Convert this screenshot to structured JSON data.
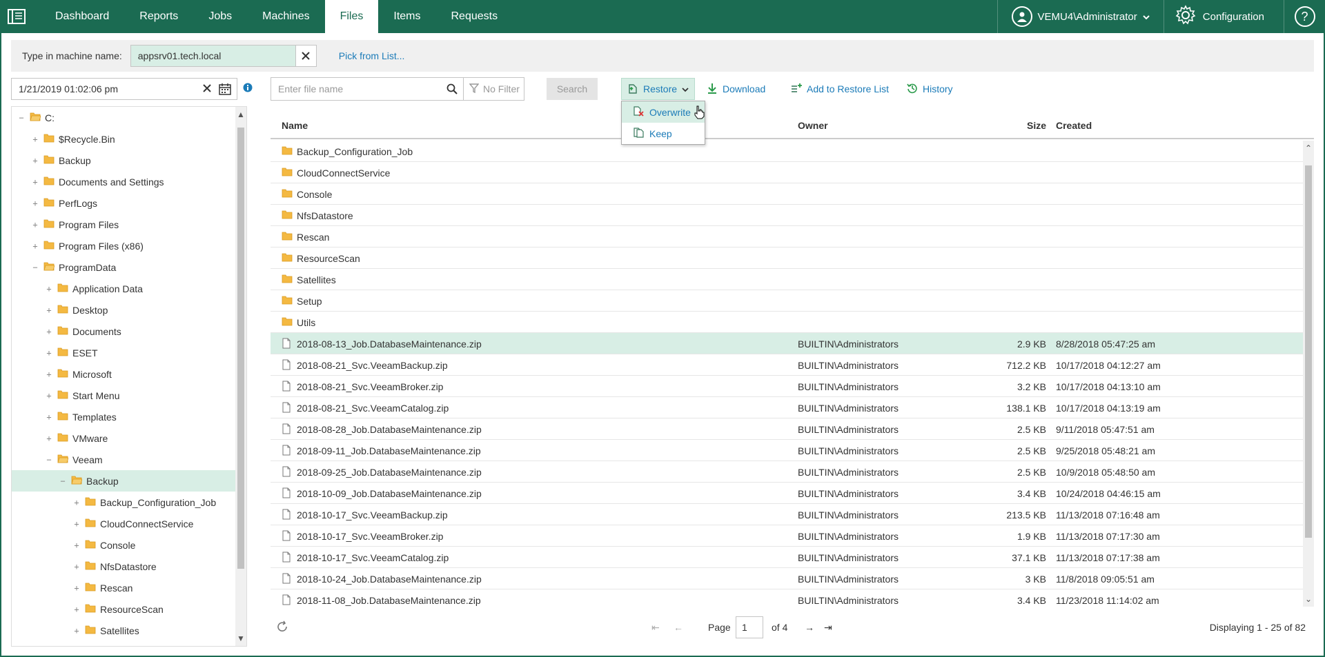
{
  "nav": {
    "tabs": [
      {
        "label": "Dashboard"
      },
      {
        "label": "Reports"
      },
      {
        "label": "Jobs"
      },
      {
        "label": "Machines"
      },
      {
        "label": "Files",
        "active": true
      },
      {
        "label": "Items"
      },
      {
        "label": "Requests"
      }
    ],
    "user": "VEMU4\\Administrator",
    "config_label": "Configuration",
    "help_label": "?"
  },
  "machine": {
    "label": "Type in machine name:",
    "value": "appsrv01.tech.local",
    "pick_link": "Pick from List..."
  },
  "date": {
    "value": "1/21/2019 01:02:06 pm"
  },
  "tree": [
    {
      "label": "C:",
      "level": 0,
      "open": true
    },
    {
      "label": "$Recycle.Bin",
      "level": 1
    },
    {
      "label": "Backup",
      "level": 1
    },
    {
      "label": "Documents and Settings",
      "level": 1
    },
    {
      "label": "PerfLogs",
      "level": 1
    },
    {
      "label": "Program Files",
      "level": 1
    },
    {
      "label": "Program Files (x86)",
      "level": 1
    },
    {
      "label": "ProgramData",
      "level": 1,
      "open": true
    },
    {
      "label": "Application Data",
      "level": 2
    },
    {
      "label": "Desktop",
      "level": 2
    },
    {
      "label": "Documents",
      "level": 2
    },
    {
      "label": "ESET",
      "level": 2
    },
    {
      "label": "Microsoft",
      "level": 2
    },
    {
      "label": "Start Menu",
      "level": 2
    },
    {
      "label": "Templates",
      "level": 2
    },
    {
      "label": "VMware",
      "level": 2
    },
    {
      "label": "Veeam",
      "level": 2,
      "open": true
    },
    {
      "label": "Backup",
      "level": 3,
      "open": true,
      "selected": true
    },
    {
      "label": "Backup_Configuration_Job",
      "level": 4
    },
    {
      "label": "CloudConnectService",
      "level": 4
    },
    {
      "label": "Console",
      "level": 4
    },
    {
      "label": "NfsDatastore",
      "level": 4
    },
    {
      "label": "Rescan",
      "level": 4
    },
    {
      "label": "ResourceScan",
      "level": 4
    },
    {
      "label": "Satellites",
      "level": 4
    }
  ],
  "toolbar": {
    "search_placeholder": "Enter file name",
    "filter_label": "No Filter",
    "search_button": "Search",
    "restore": "Restore",
    "download": "Download",
    "add_to_restore_list": "Add to Restore List",
    "history": "History"
  },
  "restore_menu": [
    {
      "label": "Overwrite"
    },
    {
      "label": "Keep"
    }
  ],
  "grid": {
    "columns": {
      "name": "Name",
      "size": "Size",
      "owner": "Owner",
      "created": "Created"
    },
    "rows": [
      {
        "type": "folder",
        "name": "Backup_Configuration_Job",
        "size": "",
        "owner": "",
        "created": ""
      },
      {
        "type": "folder",
        "name": "CloudConnectService",
        "size": "",
        "owner": "",
        "created": ""
      },
      {
        "type": "folder",
        "name": "Console",
        "size": "",
        "owner": "",
        "created": ""
      },
      {
        "type": "folder",
        "name": "NfsDatastore",
        "size": "",
        "owner": "",
        "created": ""
      },
      {
        "type": "folder",
        "name": "Rescan",
        "size": "",
        "owner": "",
        "created": ""
      },
      {
        "type": "folder",
        "name": "ResourceScan",
        "size": "",
        "owner": "",
        "created": ""
      },
      {
        "type": "folder",
        "name": "Satellites",
        "size": "",
        "owner": "",
        "created": ""
      },
      {
        "type": "folder",
        "name": "Setup",
        "size": "",
        "owner": "",
        "created": ""
      },
      {
        "type": "folder",
        "name": "Utils",
        "size": "",
        "owner": "",
        "created": ""
      },
      {
        "type": "file",
        "name": "2018-08-13_Job.DatabaseMaintenance.zip",
        "size": "2.9 KB",
        "owner": "BUILTIN\\Administrators",
        "created": "8/28/2018 05:47:25 am",
        "selected": true
      },
      {
        "type": "file",
        "name": "2018-08-21_Svc.VeeamBackup.zip",
        "size": "712.2 KB",
        "owner": "BUILTIN\\Administrators",
        "created": "10/17/2018 04:12:27 am"
      },
      {
        "type": "file",
        "name": "2018-08-21_Svc.VeeamBroker.zip",
        "size": "3.2 KB",
        "owner": "BUILTIN\\Administrators",
        "created": "10/17/2018 04:13:10 am"
      },
      {
        "type": "file",
        "name": "2018-08-21_Svc.VeeamCatalog.zip",
        "size": "138.1 KB",
        "owner": "BUILTIN\\Administrators",
        "created": "10/17/2018 04:13:19 am"
      },
      {
        "type": "file",
        "name": "2018-08-28_Job.DatabaseMaintenance.zip",
        "size": "2.5 KB",
        "owner": "BUILTIN\\Administrators",
        "created": "9/11/2018 05:47:51 am"
      },
      {
        "type": "file",
        "name": "2018-09-11_Job.DatabaseMaintenance.zip",
        "size": "2.5 KB",
        "owner": "BUILTIN\\Administrators",
        "created": "9/25/2018 05:48:21 am"
      },
      {
        "type": "file",
        "name": "2018-09-25_Job.DatabaseMaintenance.zip",
        "size": "2.5 KB",
        "owner": "BUILTIN\\Administrators",
        "created": "10/9/2018 05:48:50 am"
      },
      {
        "type": "file",
        "name": "2018-10-09_Job.DatabaseMaintenance.zip",
        "size": "3.4 KB",
        "owner": "BUILTIN\\Administrators",
        "created": "10/24/2018 04:46:15 am"
      },
      {
        "type": "file",
        "name": "2018-10-17_Svc.VeeamBackup.zip",
        "size": "213.5 KB",
        "owner": "BUILTIN\\Administrators",
        "created": "11/13/2018 07:16:48 am"
      },
      {
        "type": "file",
        "name": "2018-10-17_Svc.VeeamBroker.zip",
        "size": "1.9 KB",
        "owner": "BUILTIN\\Administrators",
        "created": "11/13/2018 07:17:30 am"
      },
      {
        "type": "file",
        "name": "2018-10-17_Svc.VeeamCatalog.zip",
        "size": "37.1 KB",
        "owner": "BUILTIN\\Administrators",
        "created": "11/13/2018 07:17:38 am"
      },
      {
        "type": "file",
        "name": "2018-10-24_Job.DatabaseMaintenance.zip",
        "size": "3 KB",
        "owner": "BUILTIN\\Administrators",
        "created": "11/8/2018 09:05:51 am"
      },
      {
        "type": "file",
        "name": "2018-11-08_Job.DatabaseMaintenance.zip",
        "size": "3.4 KB",
        "owner": "BUILTIN\\Administrators",
        "created": "11/23/2018 11:14:02 am"
      }
    ]
  },
  "pager": {
    "page_label": "Page",
    "page_value": "1",
    "of_label": "of 4",
    "displaying": "Displaying 1 - 25 of 82"
  },
  "colors": {
    "brand": "#1b6b52",
    "selection": "#d8eee5",
    "link": "#1b7bb8",
    "folder": "#f4b942"
  }
}
